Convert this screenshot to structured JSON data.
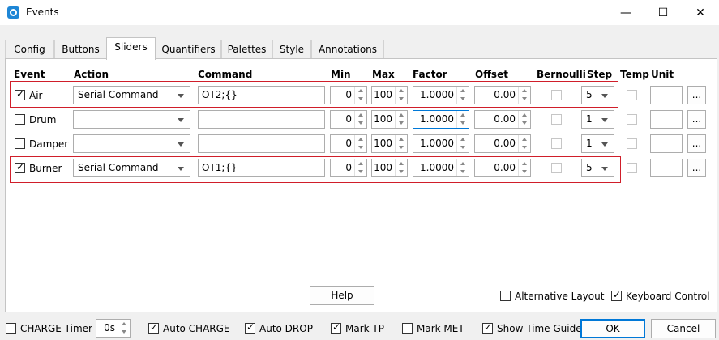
{
  "window": {
    "title": "Events",
    "minimize": "—",
    "maximize": "☐",
    "close": "✕"
  },
  "tabs": [
    {
      "label": "Config"
    },
    {
      "label": "Buttons"
    },
    {
      "label": "Sliders"
    },
    {
      "label": "Quantifiers"
    },
    {
      "label": "Palettes"
    },
    {
      "label": "Style"
    },
    {
      "label": "Annotations"
    }
  ],
  "columns": {
    "event": "Event",
    "action": "Action",
    "command": "Command",
    "min": "Min",
    "max": "Max",
    "factor": "Factor",
    "offset": "Offset",
    "bernoulli": "Bernoulli",
    "step": "Step",
    "temp": "Temp",
    "unit": "Unit"
  },
  "rows": [
    {
      "enabled": true,
      "event": "Air",
      "action": "Serial Command",
      "command": "OT2;{}",
      "min": "0",
      "max": "100",
      "factor": "1.0000",
      "offset": "0.00",
      "step": "5",
      "unit": "",
      "more": "..."
    },
    {
      "enabled": false,
      "event": "Drum",
      "action": "",
      "command": "",
      "min": "0",
      "max": "100",
      "factor": "1.0000",
      "offset": "0.00",
      "step": "1",
      "unit": "",
      "more": "..."
    },
    {
      "enabled": false,
      "event": "Damper",
      "action": "",
      "command": "",
      "min": "0",
      "max": "100",
      "factor": "1.0000",
      "offset": "0.00",
      "step": "1",
      "unit": "",
      "more": "..."
    },
    {
      "enabled": true,
      "event": "Burner",
      "action": "Serial Command",
      "command": "OT1;{}",
      "min": "0",
      "max": "100",
      "factor": "1.0000",
      "offset": "0.00",
      "step": "5",
      "unit": "",
      "more": "..."
    }
  ],
  "panel": {
    "help": "Help",
    "alternative_layout": "Alternative Layout",
    "keyboard_control": "Keyboard Control"
  },
  "footer": {
    "charge_timer": "CHARGE Timer",
    "charge_value": "0s",
    "auto_charge": "Auto CHARGE",
    "auto_drop": "Auto DROP",
    "mark_tp": "Mark TP",
    "mark_met": "Mark MET",
    "show_time_guide": "Show Time Guide",
    "ok": "OK",
    "cancel": "Cancel"
  }
}
